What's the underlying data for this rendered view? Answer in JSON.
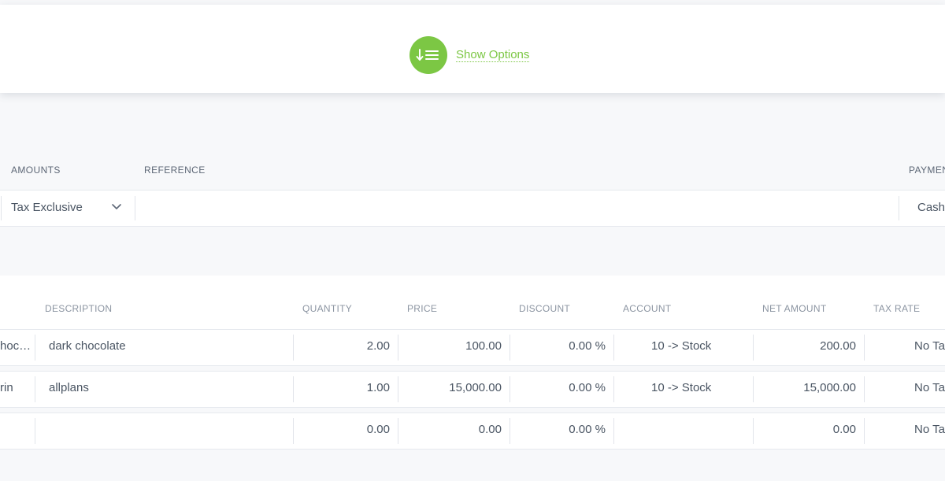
{
  "theme": {
    "accent": "#7cc744"
  },
  "options": {
    "label": "Show Options",
    "icon": "sort-list-icon"
  },
  "header_fields": {
    "amounts_label": "AMOUNTS",
    "reference_label": "REFERENCE",
    "payment_label": "PAYMEN",
    "amounts_value": "Tax Exclusive",
    "reference_value": "",
    "payment_value": "Cash"
  },
  "table": {
    "columns": {
      "description": "DESCRIPTION",
      "quantity": "QUANTITY",
      "price": "PRICE",
      "discount": "DISCOUNT",
      "account": "ACCOUNT",
      "net_amount": "NET AMOUNT",
      "tax_rate": "TAX RATE"
    },
    "rows": [
      {
        "item": "hoc…",
        "description": "dark chocolate",
        "quantity": "2.00",
        "price": "100.00",
        "discount": "0.00 %",
        "account": "10 -> Stock",
        "net_amount": "200.00",
        "tax_rate": "No Ta"
      },
      {
        "item": "rin",
        "description": "allplans",
        "quantity": "1.00",
        "price": "15,000.00",
        "discount": "0.00 %",
        "account": "10 -> Stock",
        "net_amount": "15,000.00",
        "tax_rate": "No Ta"
      },
      {
        "item": "",
        "description": "",
        "quantity": "0.00",
        "price": "0.00",
        "discount": "0.00 %",
        "account": "",
        "net_amount": "0.00",
        "tax_rate": "No Ta"
      }
    ]
  }
}
